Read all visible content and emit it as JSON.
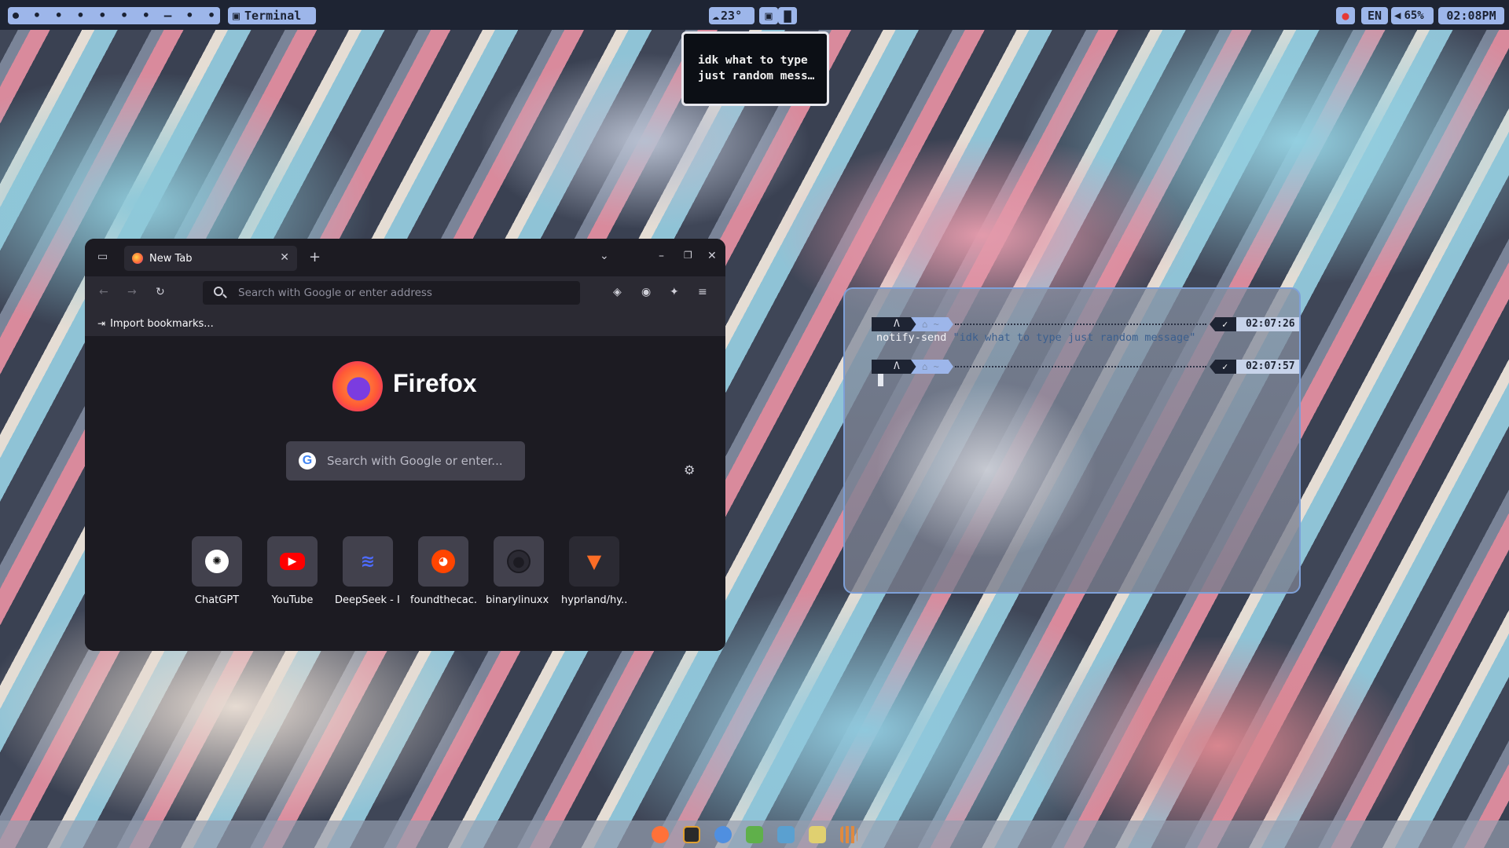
{
  "topbar": {
    "workspaces": [
      "⏺",
      "•",
      "•",
      "•",
      "•",
      "•",
      "•",
      "—",
      "•",
      "•"
    ],
    "active_window": "Terminal",
    "weather": "23°",
    "language": "EN",
    "volume": "65%",
    "clock": "02:08PM"
  },
  "notification": {
    "line1": "idk what to type",
    "line2": "just random mess…"
  },
  "firefox": {
    "tab_title": "New Tab",
    "address_placeholder": "Search with Google or enter address",
    "import_bookmarks": "Import bookmarks...",
    "brand": "Firefox",
    "search_placeholder": "Search with Google or enter...",
    "shortcuts": [
      {
        "label": "ChatGPT",
        "icon": "chatgpt-icon",
        "color": "#ffffff"
      },
      {
        "label": "YouTube",
        "icon": "youtube-icon",
        "color": "#ff0000"
      },
      {
        "label": "DeepSeek - I...",
        "icon": "deepseek-icon",
        "color": "#4d6bfe"
      },
      {
        "label": "foundthecac...",
        "icon": "reddit-icon",
        "color": "#ff4500"
      },
      {
        "label": "binarylinuxx ...",
        "icon": "github-icon",
        "color": "#2b2a33"
      },
      {
        "label": "hyprland/hy...",
        "icon": "gitlab-icon",
        "color": "#fc6d26"
      }
    ]
  },
  "terminal": {
    "prompt1_time": "02:07:26 PM",
    "command": "notify-send",
    "command_arg": "\"idk what to type just random message\"",
    "prompt2_time": "02:07:57 PM"
  },
  "dock": {
    "apps": [
      "firefox-icon",
      "terminal-icon",
      "arch-icon",
      "minecraft-icon",
      "files-icon",
      "notes-icon",
      "apps-grid-icon"
    ],
    "colors": [
      "#ff7139",
      "#e0a030",
      "#4f8fe0",
      "#5fb04a",
      "#5aa0d0",
      "#e0d070",
      "#e08a40"
    ]
  }
}
